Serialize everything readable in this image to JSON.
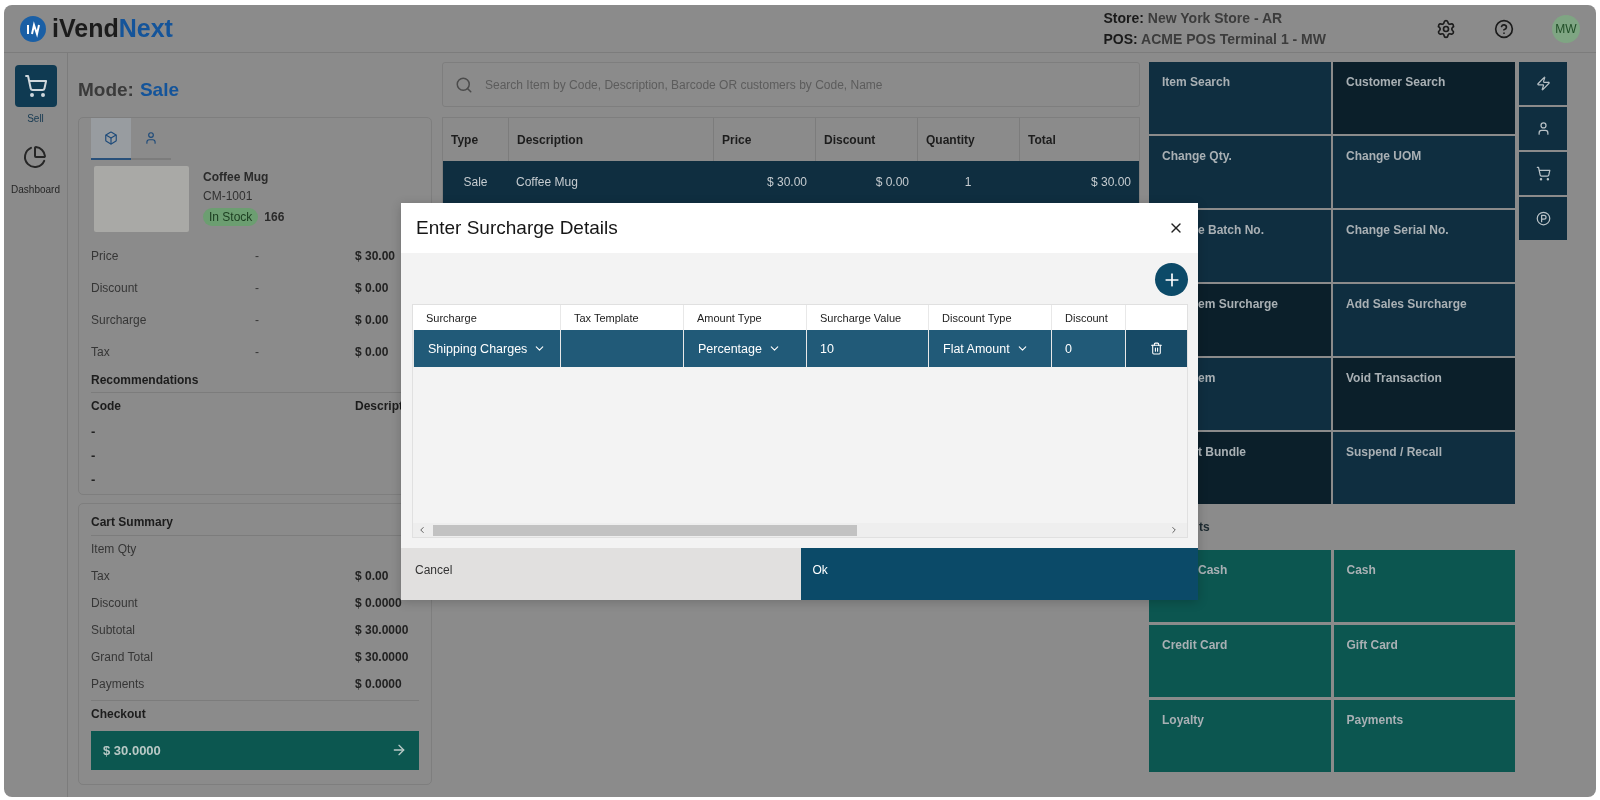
{
  "header": {
    "logo_part_1": "iVend",
    "logo_part_2": "Next",
    "store": "**Store:** New York Store - AR",
    "pos": "**POS:** ACME POS Terminal 1 - MW",
    "avatar": "MW"
  },
  "sidebar": {
    "items": [
      {
        "kind": "cart",
        "label": "Sell",
        "selected": true
      },
      {
        "kind": "pie",
        "label": "Dashboard",
        "selected": false
      }
    ]
  },
  "mode": {
    "label": "Mode:",
    "value": "Sale"
  },
  "item_panel": {
    "tabs": [
      {
        "kind": "product",
        "selected": true
      },
      {
        "kind": "customer",
        "selected": false
      }
    ],
    "product": {
      "name": "Coffee Mug",
      "code": "CM-1001",
      "stock_status": "In Stock",
      "stock_qty": "166"
    },
    "details": [
      {
        "label": "Price",
        "dash": "-",
        "value": "$ 30.00"
      },
      {
        "label": "Discount",
        "dash": "-",
        "value": "$ 0.00"
      },
      {
        "label": "Surcharge",
        "dash": "-",
        "value": "$ 0.00"
      },
      {
        "label": "Tax",
        "dash": "-",
        "value": "$ 0.00"
      }
    ],
    "recommendations": {
      "title": "Recommendations",
      "columns": [
        "Code",
        "Descript"
      ],
      "rows": [
        "-",
        "-",
        "-"
      ]
    }
  },
  "cart_summary": {
    "title": "Cart Summary",
    "rows": [
      {
        "label": "Item Qty"
      },
      {
        "label": "Tax",
        "value": "$ 0.00"
      },
      {
        "label": "Discount",
        "value": "$ 0.0000"
      },
      {
        "label": "Subtotal",
        "value": "$ 30.0000"
      },
      {
        "label": "Grand Total",
        "value": "$ 30.0000"
      },
      {
        "label": "Payments",
        "value": "$ 0.0000"
      }
    ],
    "checkout_label": "Checkout",
    "checkout_amount": "$ 30.0000"
  },
  "search": {
    "placeholder": "Search Item by Code, Description, Barcode OR customers by Code, Name"
  },
  "cart_table": {
    "columns": [
      "Type",
      "Description",
      "Price",
      "Discount",
      "Quantity",
      "Total"
    ],
    "rows": [
      {
        "selected": true,
        "cells": [
          "Sale",
          "Coffee Mug",
          "$ 30.00",
          "$ 0.00",
          "1",
          "$ 30.00"
        ]
      }
    ]
  },
  "actions": [
    {
      "label": "Item Search",
      "color": "#0f2e40"
    },
    {
      "label": "Customer Search",
      "color": "#0b1f2a"
    },
    {
      "label": "Change Qty.",
      "color": "#0f2e40"
    },
    {
      "label": "Change UOM",
      "color": "#0f2e40"
    },
    {
      "label": "e Batch No.",
      "color": "#0f2e40"
    },
    {
      "label": "Change Serial No.",
      "color": "#0f2e40"
    },
    {
      "label": "em Surcharge",
      "color": "#0b1f2a"
    },
    {
      "label": "Add Sales Surcharge",
      "color": "#0f2e40"
    },
    {
      "label": "em",
      "color": "#0f2e40"
    },
    {
      "label": "Void Transaction",
      "color": "#0b1f2a"
    },
    {
      "label": "t Bundle",
      "color": "#0b1f2a"
    },
    {
      "label": "Suspend / Recall",
      "color": "#0f2e40"
    }
  ],
  "quick_buttons": [
    {
      "kind": "bolt"
    },
    {
      "kind": "user"
    },
    {
      "kind": "cart"
    },
    {
      "kind": "points"
    }
  ],
  "payments": {
    "title": "ts",
    "items": [
      {
        "label": "Cash"
      },
      {
        "label": "Cash"
      },
      {
        "label": "Credit Card"
      },
      {
        "label": "Gift Card"
      },
      {
        "label": "Loyalty"
      },
      {
        "label": "Payments"
      }
    ]
  },
  "dialog": {
    "title": "Enter Surcharge Details",
    "columns": [
      "Surcharge",
      "Tax Template",
      "Amount Type",
      "Surcharge Value",
      "Discount Type",
      "Discount"
    ],
    "rows": [
      {
        "cells": [
          {
            "kind": "select",
            "value": "Shipping Charges"
          },
          {
            "kind": "empty"
          },
          {
            "kind": "select",
            "value": "Percentage"
          },
          {
            "kind": "text",
            "value": "10"
          },
          {
            "kind": "select",
            "value": "Flat Amount"
          },
          {
            "kind": "text",
            "value": "0"
          }
        ]
      }
    ],
    "cancel": "Cancel",
    "ok": "Ok"
  }
}
